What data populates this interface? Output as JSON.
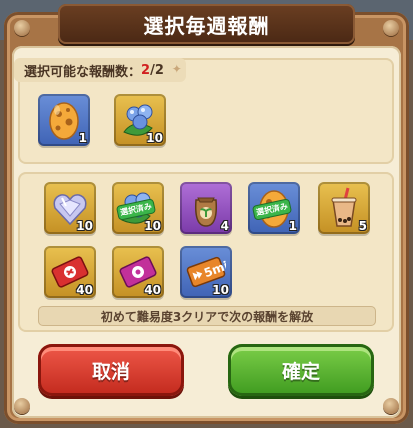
{
  "dialog": {
    "title": "選択毎週報酬",
    "count_label": "選択可能な報酬数：",
    "count_current": "2",
    "count_sep": "/",
    "count_total": "2"
  },
  "selected_rewards": [
    {
      "icon": "egg-icon",
      "qty": "1",
      "frame": "blue"
    },
    {
      "icon": "blue-berries-icon",
      "qty": "10",
      "frame": "gold"
    }
  ],
  "reward_options": [
    {
      "icon": "crystal-heart-icon",
      "qty": "10",
      "frame": "gold",
      "badge": ""
    },
    {
      "icon": "blue-berries-icon",
      "qty": "10",
      "frame": "gold",
      "badge": "選択済み"
    },
    {
      "icon": "seed-bag-icon",
      "qty": "4",
      "frame": "purple",
      "badge": ""
    },
    {
      "icon": "egg-icon",
      "qty": "1",
      "frame": "blue",
      "badge": "選択済み"
    },
    {
      "icon": "bubble-tea-icon",
      "qty": "5",
      "frame": "gold",
      "badge": ""
    },
    {
      "icon": "red-ticket-icon",
      "qty": "40",
      "frame": "gold",
      "badge": ""
    },
    {
      "icon": "purple-ticket-icon",
      "qty": "40",
      "frame": "gold",
      "badge": ""
    },
    {
      "icon": "time-skip-5min-icon",
      "qty": "10",
      "frame": "blue",
      "badge": "",
      "label": "5min"
    }
  ],
  "unlock_text": "初めて難易度3クリアで次の報酬を解放",
  "buttons": {
    "cancel": "取消",
    "confirm": "確定"
  }
}
